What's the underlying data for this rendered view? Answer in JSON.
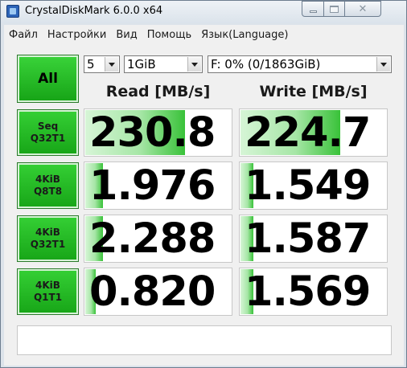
{
  "window": {
    "title": "CrystalDiskMark 6.0.0 x64"
  },
  "menu": [
    "Файл",
    "Настройки",
    "Вид",
    "Помощь",
    "Язык(Language)"
  ],
  "controls": {
    "all_label": "All",
    "count": "5",
    "size": "1GiB",
    "drive": "F: 0% (0/1863GiB)"
  },
  "headers": {
    "read": "Read [MB/s]",
    "write": "Write [MB/s]"
  },
  "tests": [
    {
      "line1": "Seq",
      "line2": "Q32T1",
      "read": "230.8",
      "write": "224.7",
      "read_fill": 0.68,
      "write_fill": 0.68
    },
    {
      "line1": "4KiB",
      "line2": "Q8T8",
      "read": "1.976",
      "write": "1.549",
      "read_fill": 0.12,
      "write_fill": 0.09
    },
    {
      "line1": "4KiB",
      "line2": "Q32T1",
      "read": "2.288",
      "write": "1.587",
      "read_fill": 0.12,
      "write_fill": 0.09
    },
    {
      "line1": "4KiB",
      "line2": "Q1T1",
      "read": "0.820",
      "write": "1.569",
      "read_fill": 0.07,
      "write_fill": 0.09
    }
  ],
  "comment": "",
  "colors": {
    "button_green": "#17a517",
    "bar_green": "#39c239"
  }
}
